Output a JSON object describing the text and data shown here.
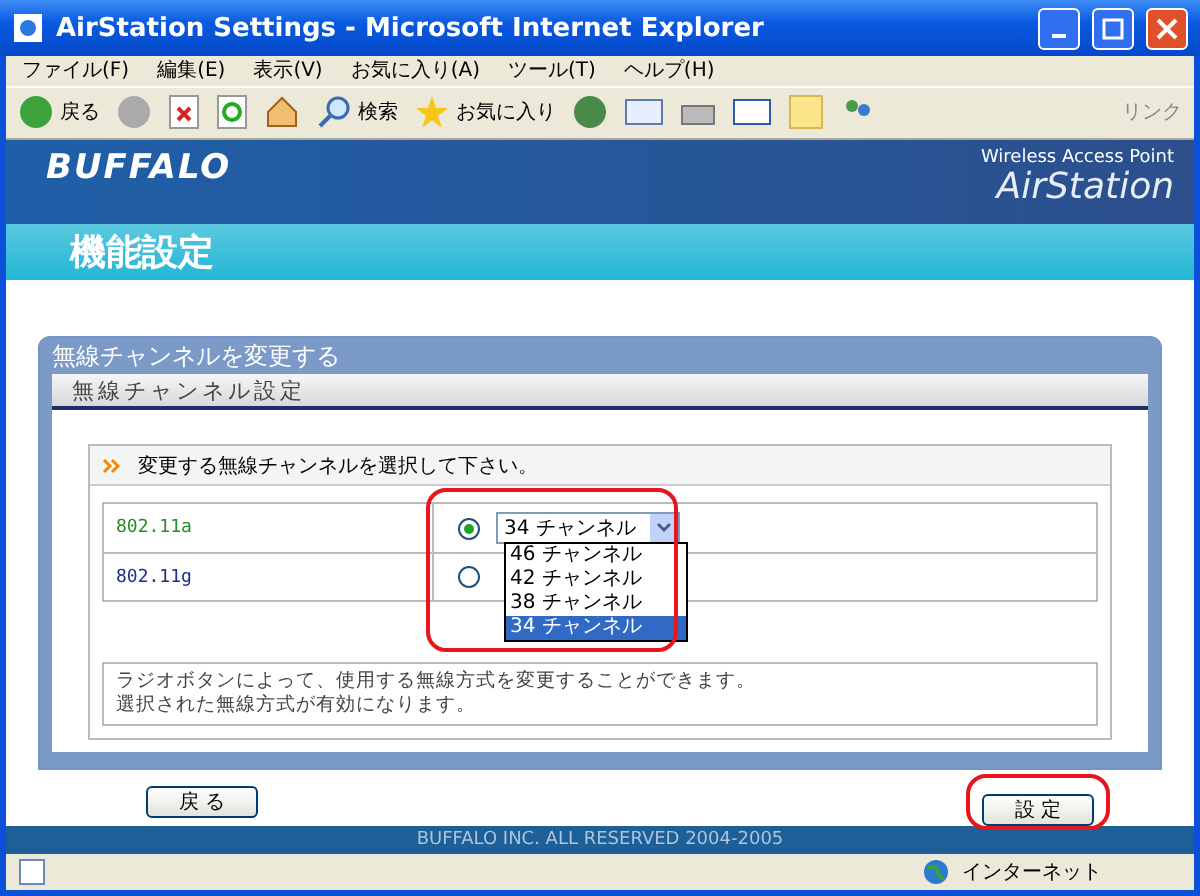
{
  "window": {
    "title": "AirStation Settings - Microsoft Internet Explorer"
  },
  "menu": [
    "ファイル(F)",
    "編集(E)",
    "表示(V)",
    "お気に入り(A)",
    "ツール(T)",
    "ヘルプ(H)"
  ],
  "toolbar": {
    "back": "戻る",
    "search": "検索",
    "favorites": "お気に入り",
    "links": "リンク"
  },
  "header": {
    "brand": "BUFFALO",
    "product": "Wireless Access Point",
    "logo": "AirStation",
    "page_title": "機能設定"
  },
  "panel": {
    "title": "無線チャンネルを変更する",
    "subtitle": "無線チャンネル設定",
    "instruction": "変更する無線チャンネルを選択して下さい。",
    "rows": [
      {
        "label": "802.11a",
        "selected": true,
        "channel": "34 チャンネル"
      },
      {
        "label": "802.11g",
        "selected": false
      }
    ],
    "dropdown_options": [
      {
        "label": "46 チャンネル",
        "selected": false
      },
      {
        "label": "42 チャンネル",
        "selected": false
      },
      {
        "label": "38 チャンネル",
        "selected": false
      },
      {
        "label": "34 チャンネル",
        "selected": true
      }
    ],
    "help": [
      "ラジオボタンによって、使用する無線方式を変更することができます。",
      "選択された無線方式が有効になります。"
    ]
  },
  "buttons": {
    "back": "戻 る",
    "apply": "設 定"
  },
  "footer": "BUFFALO INC. ALL RESERVED 2004-2005",
  "status_bar": {
    "zone": "インターネット"
  }
}
